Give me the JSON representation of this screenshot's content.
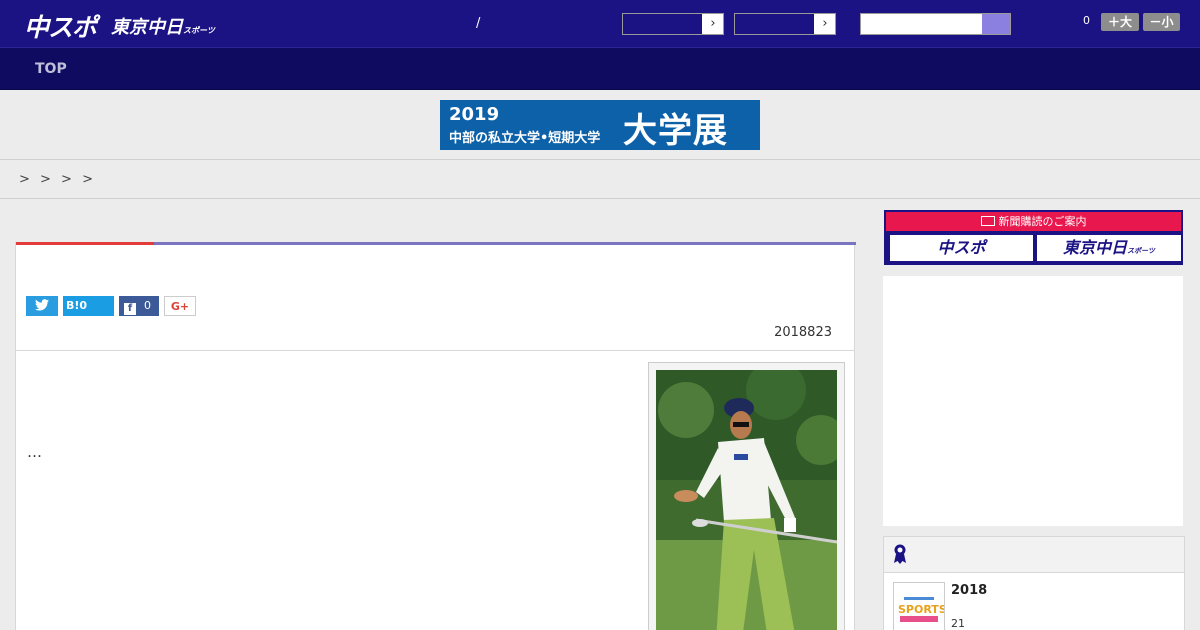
{
  "header": {
    "logo_main": "中スポ",
    "logo_sub": "東京中日",
    "logo_sub_small": "スポーツ",
    "separator": "/",
    "font_size_value": "0",
    "font_larger": "＋大",
    "font_smaller": "－小"
  },
  "nav": {
    "top_label": "TOP"
  },
  "banner": {
    "year": "2019",
    "subtitle": "中部の私立大学•短期大学",
    "headline": "大学展"
  },
  "breadcrumb": {
    "text": "> > > >"
  },
  "article": {
    "share": {
      "hatena_label": "B!0",
      "facebook_count": "0",
      "gplus_label": "G+"
    },
    "date": "2018823",
    "body_text": "…"
  },
  "sidebar": {
    "subscribe_head": "新聞購読のご案内",
    "subscribe_tile1": "中スポ",
    "subscribe_tile2": "東京中日",
    "subscribe_tile2_small": "スポーツ",
    "ranking": {
      "item_title": "2018",
      "item_meta": "21"
    }
  },
  "colors": {
    "header_bg": "#1b1284",
    "nav_bg": "#0f0b61",
    "accent_red": "#e33a3a",
    "subscribe_red": "#e8174d"
  }
}
